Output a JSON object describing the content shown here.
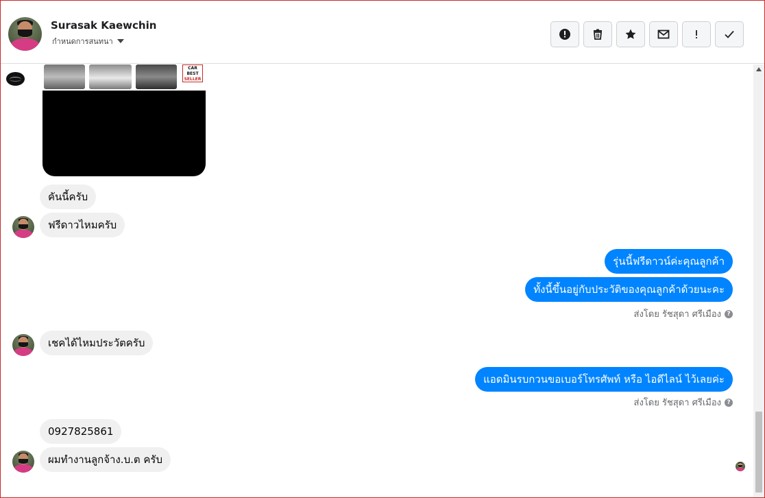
{
  "header": {
    "contact_name": "Surasak Kaewchin",
    "conversation_settings_label": "กำหนดการสนทนา",
    "actions": [
      {
        "name": "mark-spam-button",
        "icon": "alert-circle-icon"
      },
      {
        "name": "delete-button",
        "icon": "trash-icon"
      },
      {
        "name": "star-button",
        "icon": "star-icon"
      },
      {
        "name": "mark-unread-button",
        "icon": "envelope-icon"
      },
      {
        "name": "follow-up-button",
        "icon": "exclamation-icon"
      },
      {
        "name": "mark-done-button",
        "icon": "checkmark-icon"
      }
    ]
  },
  "shared_image": {
    "badge_line1": "CAR",
    "badge_line2": "BEST",
    "badge_line3": "SELLER"
  },
  "messages": [
    {
      "side": "in",
      "text": "คันนี้ครับ"
    },
    {
      "side": "in",
      "text": "ฟรีดาวไหมครับ"
    },
    {
      "side": "out",
      "text": "รุ่นนี้ฟรีดาวน์ค่ะคุณลูกค้า"
    },
    {
      "side": "out",
      "text": "ทั้งนี้ขึ้นอยู่กับประวัติของคุณลูกค้าด้วยนะคะ"
    },
    {
      "side": "in",
      "text": "เชคได้ไหมประวัตครับ"
    },
    {
      "side": "out",
      "text": "แอดมินรบกวนขอเบอร์โทรศัพท์ หรือ ไอดีไลน์  ไว้เลยค่ะ"
    },
    {
      "side": "in",
      "text": "0927825861"
    },
    {
      "side": "in",
      "text": "ผมทำงานลูกจ้าง.บ.ต ครับ"
    }
  ],
  "sent_by_label": "ส่งโดย รัชสุดา ศรีเมือง",
  "help_glyph": "?",
  "colors": {
    "outgoing_bubble": "#0084ff",
    "incoming_bubble": "#f0f0f0",
    "frame_border": "#c62828"
  }
}
